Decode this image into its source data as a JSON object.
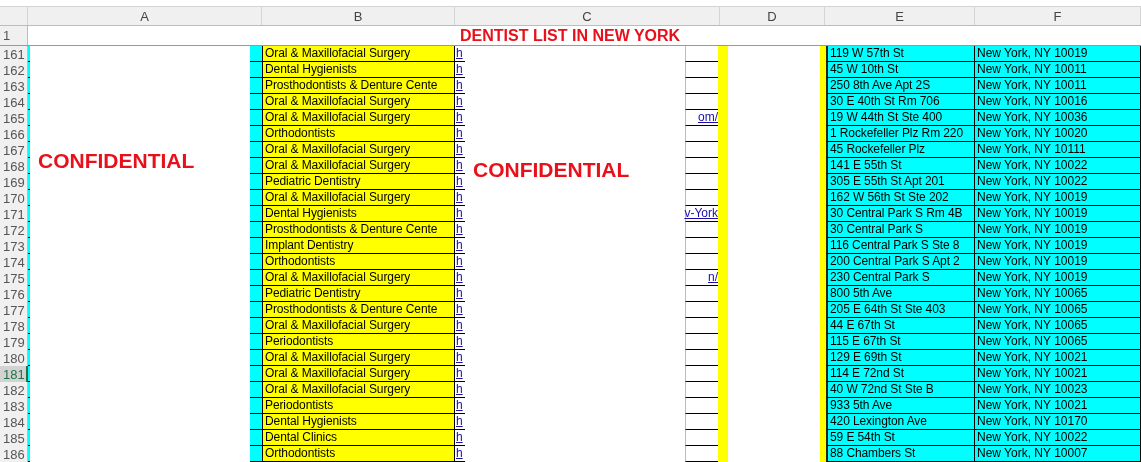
{
  "column_headers": [
    "A",
    "B",
    "C",
    "D",
    "E",
    "F"
  ],
  "title_row": {
    "number": "1",
    "title": "DENTIST LIST IN NEW YORK"
  },
  "overlays": [
    "CONFIDENTIAL",
    "CONFIDENTIAL"
  ],
  "rows": [
    {
      "number": "161",
      "specialty": "Oral & Maxillofacial Surgery",
      "link": "h",
      "address": "119 W 57th St",
      "city": "New York, NY 10019",
      "selected": false
    },
    {
      "number": "162",
      "specialty": "Dental Hygienists",
      "link": "h",
      "address": "45 W 10th St",
      "city": "New York, NY 10011",
      "selected": false
    },
    {
      "number": "163",
      "specialty": "Prosthodontists & Denture Cente",
      "link": "h",
      "address": "250 8th Ave Apt 2S",
      "city": "New York, NY 10011",
      "selected": false
    },
    {
      "number": "164",
      "specialty": "Oral & Maxillofacial Surgery",
      "link": "h",
      "address": "30 E 40th St Rm 706",
      "city": "New York, NY 10016",
      "selected": false
    },
    {
      "number": "165",
      "specialty": "Oral & Maxillofacial Surgery",
      "link": "h",
      "link_tail": "om/",
      "address": "19 W 44th St Ste 400",
      "city": "New York, NY 10036",
      "selected": false
    },
    {
      "number": "166",
      "specialty": "Orthodontists",
      "link": "h",
      "address": "1 Rockefeller Plz Rm 220",
      "city": "New York, NY 10020",
      "selected": false
    },
    {
      "number": "167",
      "specialty": "Oral & Maxillofacial Surgery",
      "link": "h",
      "address": "45 Rockefeller Plz",
      "city": "New York, NY 10111",
      "selected": false
    },
    {
      "number": "168",
      "specialty": "Oral & Maxillofacial Surgery",
      "link": "h",
      "address": "141 E 55th St",
      "city": "New York, NY 10022",
      "selected": false
    },
    {
      "number": "169",
      "specialty": "Pediatric Dentistry",
      "link": "h",
      "address": "305 E 55th St Apt 201",
      "city": "New York, NY 10022",
      "selected": false
    },
    {
      "number": "170",
      "specialty": "Oral & Maxillofacial Surgery",
      "link": "h",
      "address": "162 W 56th St Ste 202",
      "city": "New York, NY 10019",
      "selected": false
    },
    {
      "number": "171",
      "specialty": "Dental Hygienists",
      "link": "h",
      "link_tail": "v-York",
      "address": "30 Central Park S Rm 4B",
      "city": "New York, NY 10019",
      "selected": false
    },
    {
      "number": "172",
      "specialty": "Prosthodontists & Denture Cente",
      "link": "h",
      "address": "30 Central Park S",
      "city": "New York, NY 10019",
      "selected": false
    },
    {
      "number": "173",
      "specialty": "Implant Dentistry",
      "link": "h",
      "address": "116 Central Park S Ste 8",
      "city": "New York, NY 10019",
      "selected": false
    },
    {
      "number": "174",
      "specialty": "Orthodontists",
      "link": "h",
      "address": "200 Central Park S Apt 2",
      "city": "New York, NY 10019",
      "selected": false
    },
    {
      "number": "175",
      "specialty": "Oral & Maxillofacial Surgery",
      "link": "h",
      "link_tail": "n/",
      "address": "230 Central Park S",
      "city": "New York, NY 10019",
      "selected": false
    },
    {
      "number": "176",
      "specialty": "Pediatric Dentistry",
      "link": "h",
      "address": "800 5th Ave",
      "city": "New York, NY 10065",
      "selected": false
    },
    {
      "number": "177",
      "specialty": "Prosthodontists & Denture Cente",
      "link": "h",
      "address": "205 E 64th St Ste 403",
      "city": "New York, NY 10065",
      "selected": false
    },
    {
      "number": "178",
      "specialty": "Oral & Maxillofacial Surgery",
      "link": "h",
      "address": "44 E 67th St",
      "city": "New York, NY 10065",
      "selected": false
    },
    {
      "number": "179",
      "specialty": "Periodontists",
      "link": "h",
      "address": "115 E 67th St",
      "city": "New York, NY 10065",
      "selected": false
    },
    {
      "number": "180",
      "specialty": "Oral & Maxillofacial Surgery",
      "link": "h",
      "address": "129 E 69th St",
      "city": "New York, NY 10021",
      "selected": false
    },
    {
      "number": "181",
      "specialty": "Oral & Maxillofacial Surgery",
      "link": "h",
      "address": "114 E 72nd St",
      "city": "New York, NY 10021",
      "selected": true
    },
    {
      "number": "182",
      "specialty": "Oral & Maxillofacial Surgery",
      "link": "h",
      "address": "40 W 72nd St Ste B",
      "city": "New York, NY 10023",
      "selected": false
    },
    {
      "number": "183",
      "specialty": "Periodontists",
      "link": "h",
      "address": "933 5th Ave",
      "city": "New York, NY 10021",
      "selected": false
    },
    {
      "number": "184",
      "specialty": "Dental Hygienists",
      "link": "h",
      "address": "420 Lexington Ave",
      "city": "New York, NY 10170",
      "selected": false
    },
    {
      "number": "185",
      "specialty": "Dental Clinics",
      "link": "h",
      "address": "59 E 54th St",
      "city": "New York, NY 10022",
      "selected": false
    },
    {
      "number": "186",
      "specialty": "Orthodontists",
      "link": "h",
      "address": "88 Chambers St",
      "city": "New York, NY 10007",
      "selected": false
    }
  ]
}
